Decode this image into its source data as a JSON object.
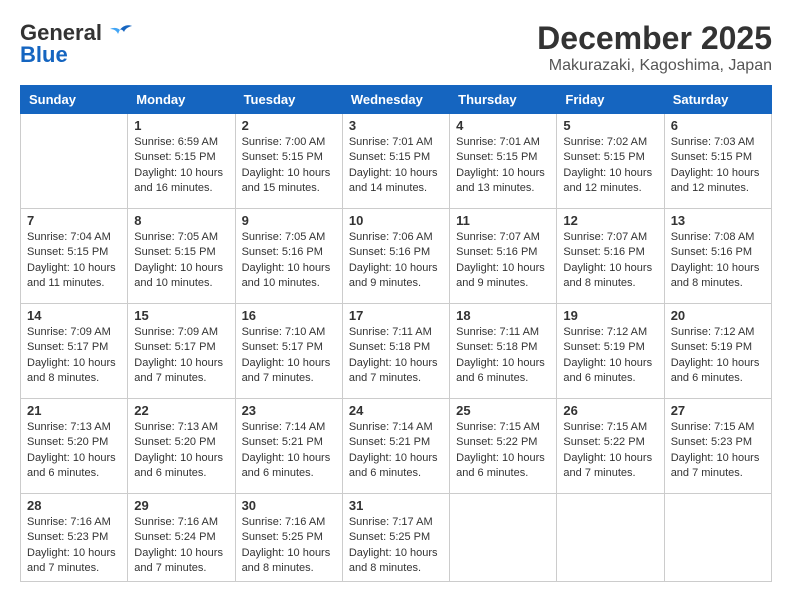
{
  "logo": {
    "line1": "General",
    "line2": "Blue"
  },
  "title": "December 2025",
  "subtitle": "Makurazaki, Kagoshima, Japan",
  "headers": [
    "Sunday",
    "Monday",
    "Tuesday",
    "Wednesday",
    "Thursday",
    "Friday",
    "Saturday"
  ],
  "weeks": [
    [
      {
        "day": "",
        "info": ""
      },
      {
        "day": "1",
        "info": "Sunrise: 6:59 AM\nSunset: 5:15 PM\nDaylight: 10 hours\nand 16 minutes."
      },
      {
        "day": "2",
        "info": "Sunrise: 7:00 AM\nSunset: 5:15 PM\nDaylight: 10 hours\nand 15 minutes."
      },
      {
        "day": "3",
        "info": "Sunrise: 7:01 AM\nSunset: 5:15 PM\nDaylight: 10 hours\nand 14 minutes."
      },
      {
        "day": "4",
        "info": "Sunrise: 7:01 AM\nSunset: 5:15 PM\nDaylight: 10 hours\nand 13 minutes."
      },
      {
        "day": "5",
        "info": "Sunrise: 7:02 AM\nSunset: 5:15 PM\nDaylight: 10 hours\nand 12 minutes."
      },
      {
        "day": "6",
        "info": "Sunrise: 7:03 AM\nSunset: 5:15 PM\nDaylight: 10 hours\nand 12 minutes."
      }
    ],
    [
      {
        "day": "7",
        "info": "Sunrise: 7:04 AM\nSunset: 5:15 PM\nDaylight: 10 hours\nand 11 minutes."
      },
      {
        "day": "8",
        "info": "Sunrise: 7:05 AM\nSunset: 5:15 PM\nDaylight: 10 hours\nand 10 minutes."
      },
      {
        "day": "9",
        "info": "Sunrise: 7:05 AM\nSunset: 5:16 PM\nDaylight: 10 hours\nand 10 minutes."
      },
      {
        "day": "10",
        "info": "Sunrise: 7:06 AM\nSunset: 5:16 PM\nDaylight: 10 hours\nand 9 minutes."
      },
      {
        "day": "11",
        "info": "Sunrise: 7:07 AM\nSunset: 5:16 PM\nDaylight: 10 hours\nand 9 minutes."
      },
      {
        "day": "12",
        "info": "Sunrise: 7:07 AM\nSunset: 5:16 PM\nDaylight: 10 hours\nand 8 minutes."
      },
      {
        "day": "13",
        "info": "Sunrise: 7:08 AM\nSunset: 5:16 PM\nDaylight: 10 hours\nand 8 minutes."
      }
    ],
    [
      {
        "day": "14",
        "info": "Sunrise: 7:09 AM\nSunset: 5:17 PM\nDaylight: 10 hours\nand 8 minutes."
      },
      {
        "day": "15",
        "info": "Sunrise: 7:09 AM\nSunset: 5:17 PM\nDaylight: 10 hours\nand 7 minutes."
      },
      {
        "day": "16",
        "info": "Sunrise: 7:10 AM\nSunset: 5:17 PM\nDaylight: 10 hours\nand 7 minutes."
      },
      {
        "day": "17",
        "info": "Sunrise: 7:11 AM\nSunset: 5:18 PM\nDaylight: 10 hours\nand 7 minutes."
      },
      {
        "day": "18",
        "info": "Sunrise: 7:11 AM\nSunset: 5:18 PM\nDaylight: 10 hours\nand 6 minutes."
      },
      {
        "day": "19",
        "info": "Sunrise: 7:12 AM\nSunset: 5:19 PM\nDaylight: 10 hours\nand 6 minutes."
      },
      {
        "day": "20",
        "info": "Sunrise: 7:12 AM\nSunset: 5:19 PM\nDaylight: 10 hours\nand 6 minutes."
      }
    ],
    [
      {
        "day": "21",
        "info": "Sunrise: 7:13 AM\nSunset: 5:20 PM\nDaylight: 10 hours\nand 6 minutes."
      },
      {
        "day": "22",
        "info": "Sunrise: 7:13 AM\nSunset: 5:20 PM\nDaylight: 10 hours\nand 6 minutes."
      },
      {
        "day": "23",
        "info": "Sunrise: 7:14 AM\nSunset: 5:21 PM\nDaylight: 10 hours\nand 6 minutes."
      },
      {
        "day": "24",
        "info": "Sunrise: 7:14 AM\nSunset: 5:21 PM\nDaylight: 10 hours\nand 6 minutes."
      },
      {
        "day": "25",
        "info": "Sunrise: 7:15 AM\nSunset: 5:22 PM\nDaylight: 10 hours\nand 6 minutes."
      },
      {
        "day": "26",
        "info": "Sunrise: 7:15 AM\nSunset: 5:22 PM\nDaylight: 10 hours\nand 7 minutes."
      },
      {
        "day": "27",
        "info": "Sunrise: 7:15 AM\nSunset: 5:23 PM\nDaylight: 10 hours\nand 7 minutes."
      }
    ],
    [
      {
        "day": "28",
        "info": "Sunrise: 7:16 AM\nSunset: 5:23 PM\nDaylight: 10 hours\nand 7 minutes."
      },
      {
        "day": "29",
        "info": "Sunrise: 7:16 AM\nSunset: 5:24 PM\nDaylight: 10 hours\nand 7 minutes."
      },
      {
        "day": "30",
        "info": "Sunrise: 7:16 AM\nSunset: 5:25 PM\nDaylight: 10 hours\nand 8 minutes."
      },
      {
        "day": "31",
        "info": "Sunrise: 7:17 AM\nSunset: 5:25 PM\nDaylight: 10 hours\nand 8 minutes."
      },
      {
        "day": "",
        "info": ""
      },
      {
        "day": "",
        "info": ""
      },
      {
        "day": "",
        "info": ""
      }
    ]
  ]
}
